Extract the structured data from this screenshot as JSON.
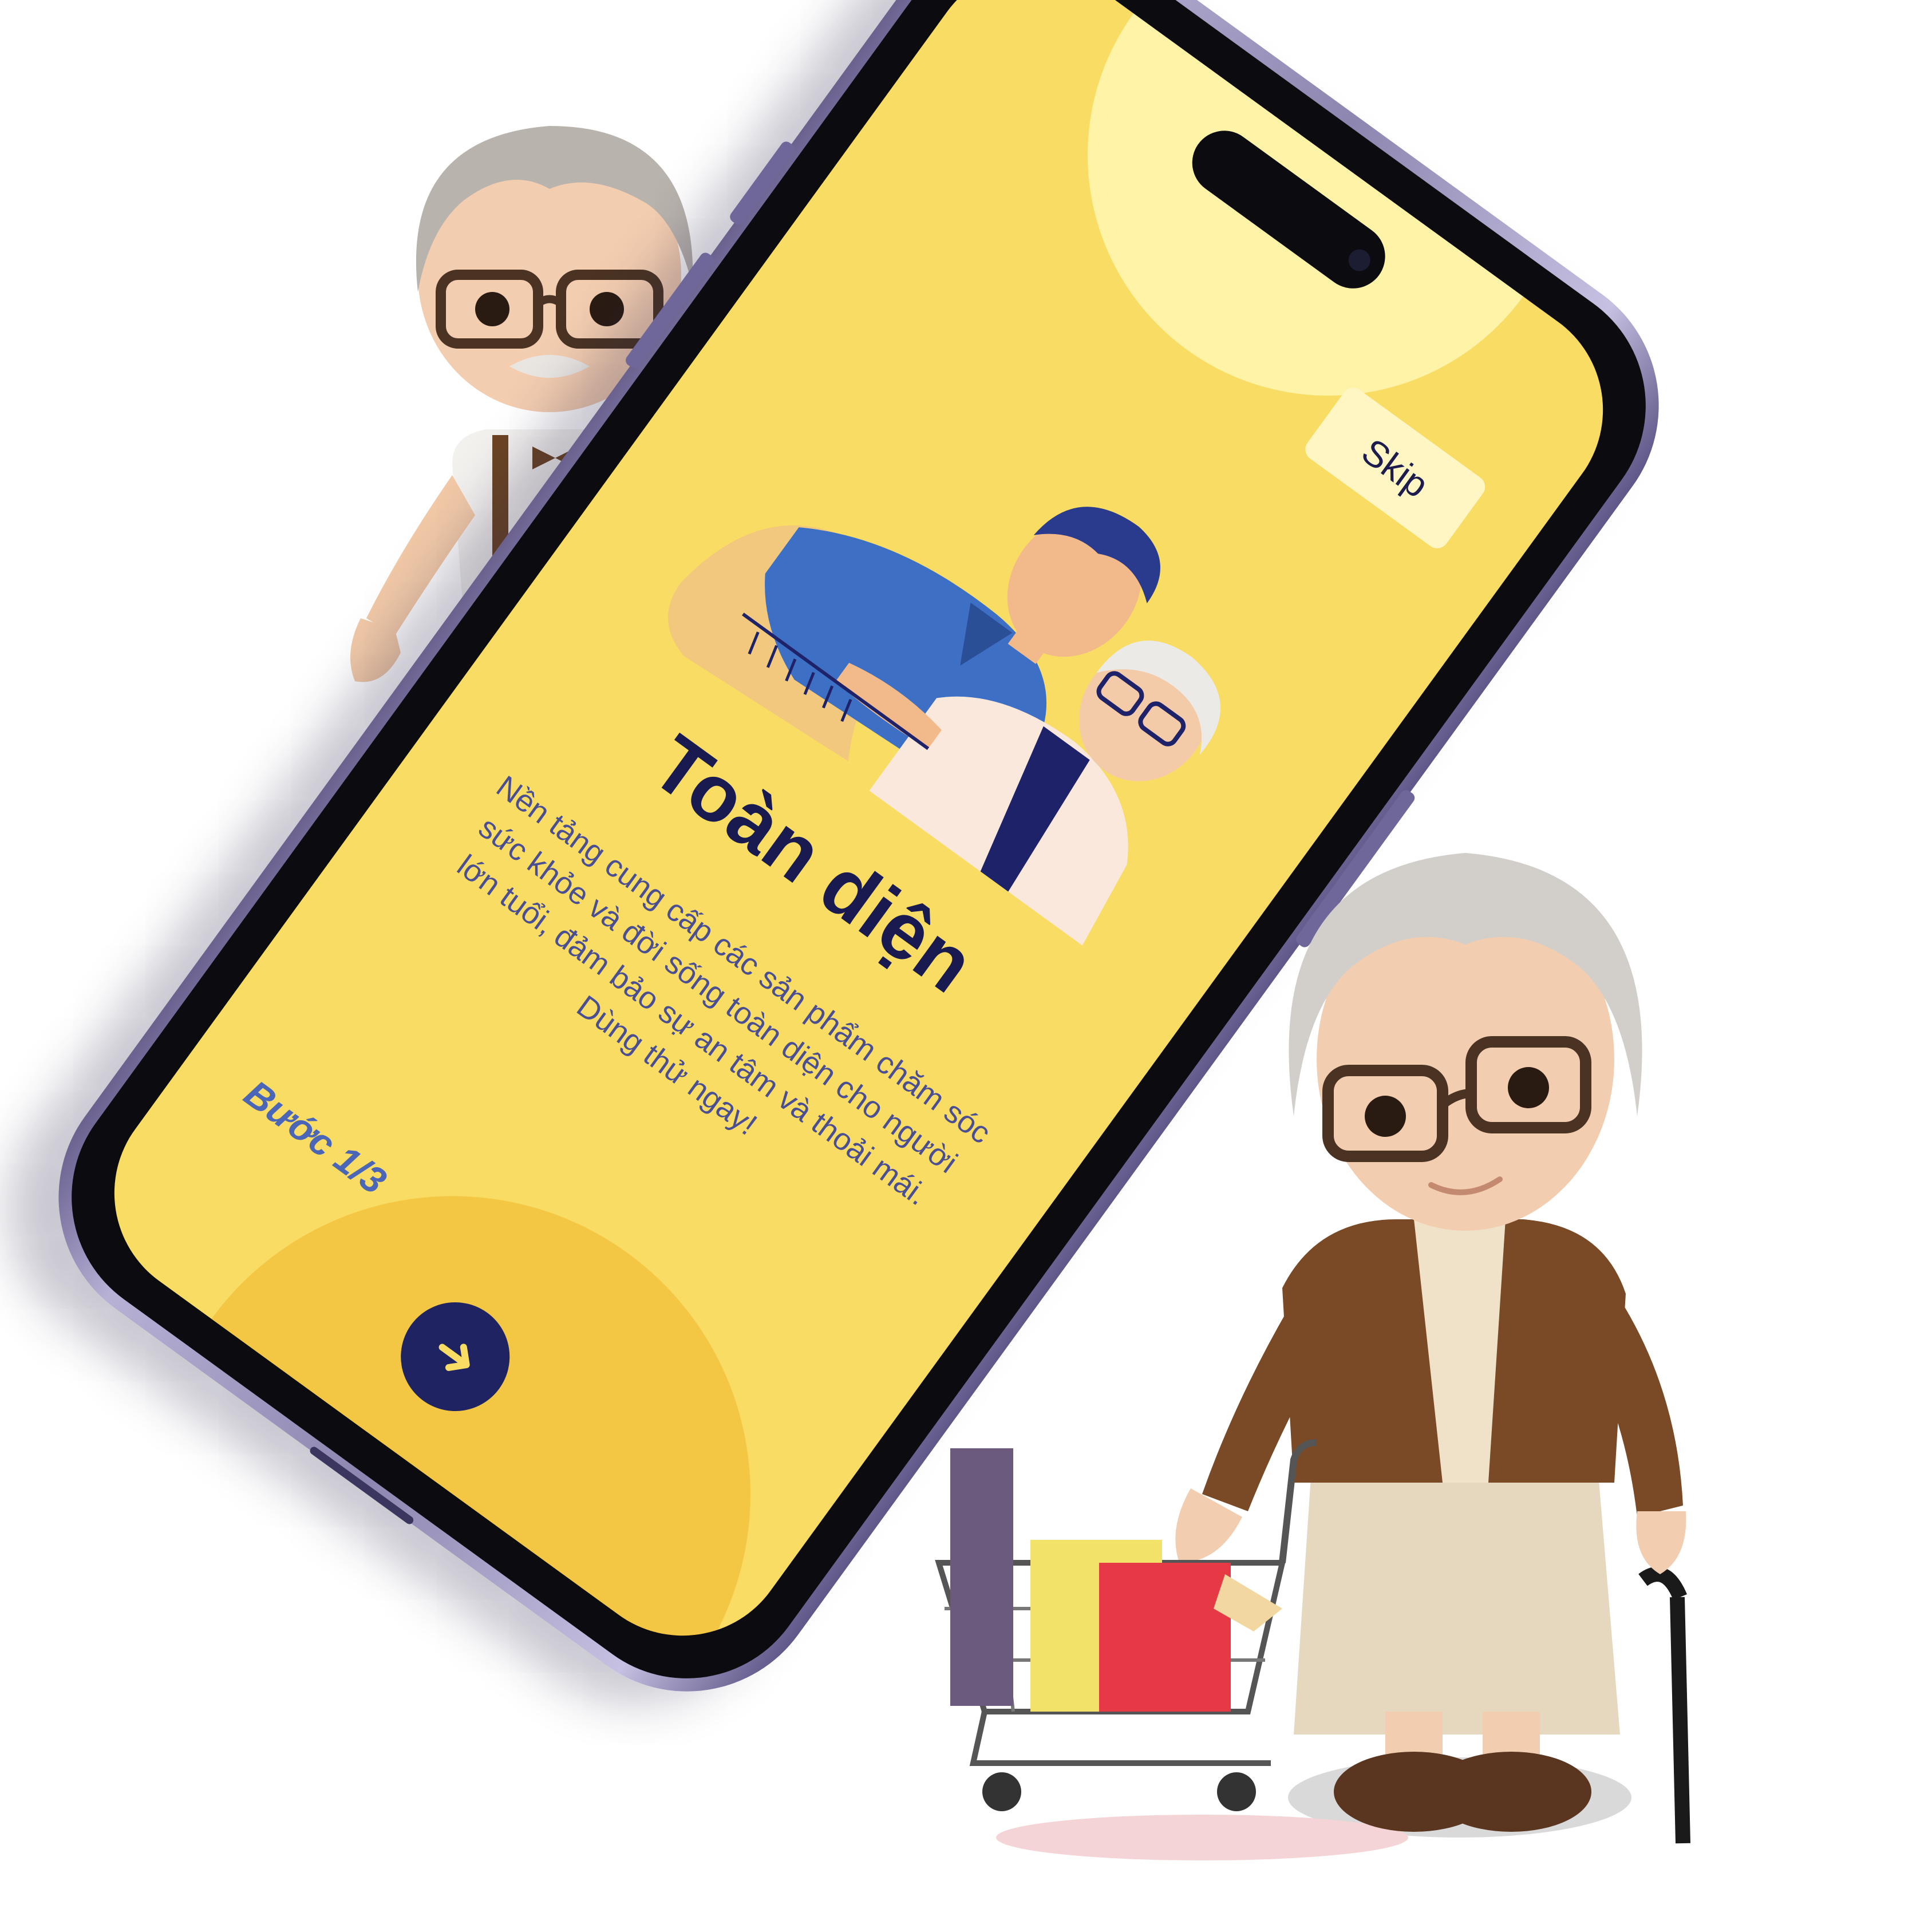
{
  "onboarding": {
    "skip_label": "Skip",
    "title": "Toàn diện",
    "description": "Nền tảng cung cấp các sản phẩm chăm sóc sức khỏe và đời sống toàn diện cho người lớn tuổi, đảm bảo sự an tâm và thoải mái. Dùng thử ngay!",
    "step_label": "Bước 1/3",
    "next_icon": "arrow-right-icon"
  },
  "illustration": {
    "subject": "caregiver-with-elderly-man-illustration"
  },
  "decor": {
    "left_figure": "elderly-man-figure",
    "right_figure": "elderly-woman-with-cart-figure"
  },
  "colors": {
    "screen_bg": "#f9dc63",
    "title": "#191a50",
    "body_text": "#4a4e93",
    "accent_blue": "#4b66b6",
    "next_button": "#1f2362",
    "skip_bg": "#fff6c4"
  }
}
